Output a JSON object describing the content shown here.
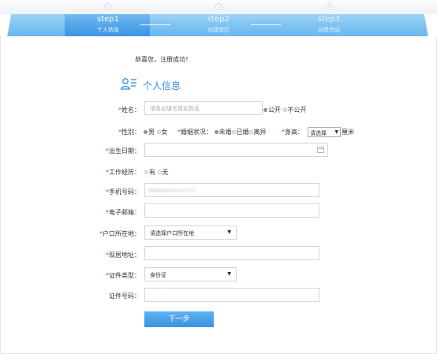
{
  "steps": [
    {
      "title": "step1",
      "subtitle": "个人信息"
    },
    {
      "title": "step2",
      "subtitle": "创建简历"
    },
    {
      "title": "step3",
      "subtitle": "创建完成"
    }
  ],
  "congrats": "恭喜您，注册成功！",
  "section_title": "个人信息",
  "required_mark": "*",
  "name": {
    "label": "姓名：",
    "placeholder": "请务必填写真实姓名",
    "public": "公开",
    "private": "不公开"
  },
  "gender": {
    "label": "性别：",
    "options": [
      "男",
      "女"
    ]
  },
  "marital": {
    "label": "婚姻状况：",
    "options": [
      "未婚",
      "已婚",
      "离异"
    ]
  },
  "height": {
    "label": "身高：",
    "select_value": "请选择",
    "unit": "厘米"
  },
  "birth": {
    "label": "出生日期："
  },
  "experience": {
    "label": "工作经历：",
    "options": [
      "有",
      "无"
    ]
  },
  "phone": {
    "label": "手机号码："
  },
  "email": {
    "label": "电子邮箱："
  },
  "hukou": {
    "label": "户口所在地：",
    "select_value": "请选择户口所在地"
  },
  "address": {
    "label": "现居地址："
  },
  "id_type": {
    "label": "证件类型：",
    "select_value": "身份证"
  },
  "id_number": {
    "label": "证件号码："
  },
  "next_button": "下一步",
  "colors": {
    "accent": "#3a94e2",
    "step_bar": "#7ec3f2",
    "required": "#e4393c"
  }
}
